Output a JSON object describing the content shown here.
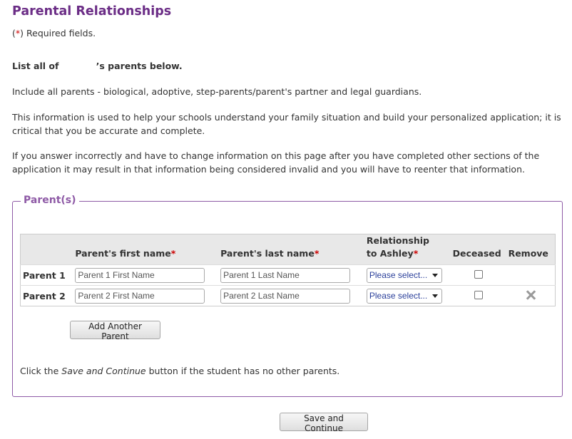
{
  "page": {
    "title": "Parental Relationships",
    "required_note_star": "*",
    "required_note_text": "Required fields."
  },
  "intro": {
    "heading_prefix": "List all of",
    "heading_suffix": "’s parents below.",
    "paragraph1": "Include all parents - biological, adoptive, step-parents/parent's partner and legal guardians.",
    "paragraph2": "This information is used to help your schools understand your family situation and build your personalized application; it is critical that you be accurate and complete.",
    "paragraph3": "If you answer incorrectly and have to change information on this page after you have completed other sections of the application it may result in that information being considered invalid and you will have to reenter that information."
  },
  "parents_section": {
    "legend": "Parent(s)",
    "columns": {
      "first_name": "Parent's first name",
      "last_name": "Parent's last name",
      "relationship_line1": "Relationship",
      "relationship_line2": "to Ashley",
      "deceased": "Deceased",
      "remove": "Remove",
      "required_star": "*"
    },
    "rows": [
      {
        "label": "Parent 1",
        "first_name_placeholder": "Parent 1 First Name",
        "last_name_placeholder": "Parent 1 Last Name",
        "relationship_selected": "Please select...",
        "deceased_checked": false,
        "removable": false
      },
      {
        "label": "Parent 2",
        "first_name_placeholder": "Parent 2 First Name",
        "last_name_placeholder": "Parent 2 Last Name",
        "relationship_selected": "Please select...",
        "deceased_checked": false,
        "removable": true,
        "remove_icon": "close-icon"
      }
    ],
    "add_button_label": "Add Another Parent",
    "hint_prefix": "Click the",
    "hint_emphasis": "Save and Continue",
    "hint_suffix": "button if the student has no other parents."
  },
  "footer": {
    "save_button_label": "Save and Continue"
  },
  "colors": {
    "title": "#6b2d86",
    "fieldset_border": "#8e5aa6",
    "required_star": "#cc0000",
    "select_text": "#2a3f9a"
  }
}
